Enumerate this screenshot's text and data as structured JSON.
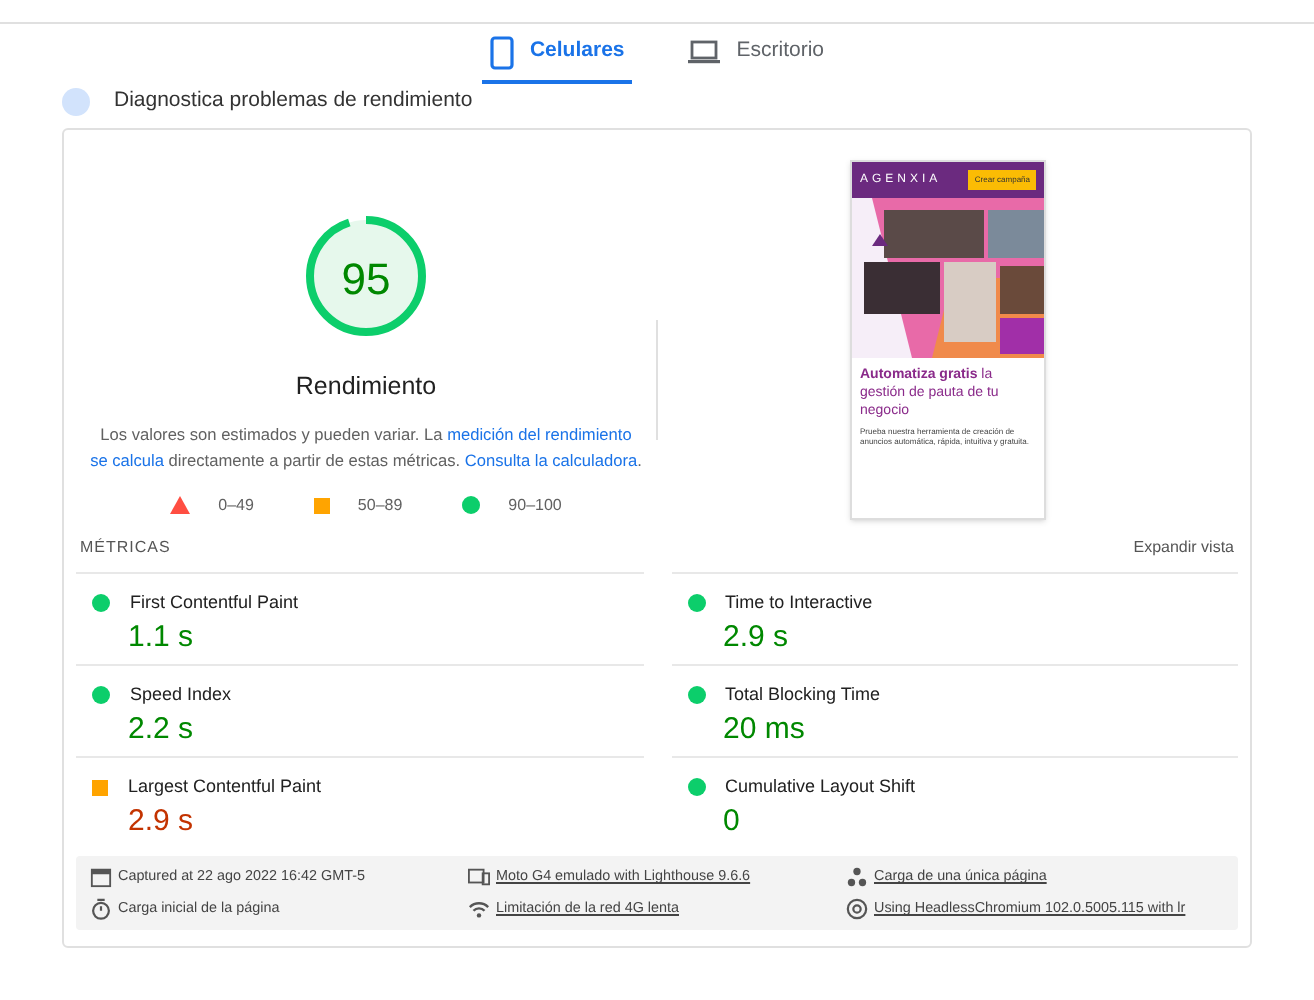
{
  "tabs": [
    {
      "label": "Celulares",
      "kind": "phone",
      "selected": true
    },
    {
      "label": "Escritorio",
      "kind": "desktop",
      "selected": false
    }
  ],
  "diagnostic_heading": "Diagnostica problemas de rendimiento",
  "score": {
    "value": "95",
    "level": 0.95,
    "label": "Rendimiento"
  },
  "description": {
    "text": "Los valores son estimados y pueden variar. La ",
    "link1": "medición del rendimiento",
    "link1_cont": "se calcula",
    "middle": " directamente a partir de estas métricas. ",
    "link2": "Consulta la calculadora",
    "end": "."
  },
  "legend": [
    {
      "kind": "fail",
      "range": "0–49"
    },
    {
      "kind": "average",
      "range": "50–89"
    },
    {
      "kind": "pass",
      "range": "90–100"
    }
  ],
  "screenshot": {
    "brand": "AGENXIA",
    "button": "Crear campaña",
    "headline_bold": "Automatiza gratis",
    "headline_rest": " la gestión de pauta de tu negocio",
    "body": "Prueba nuestra herramienta de creación de anuncios automática, rápida, intuitiva y gratuita."
  },
  "metrics_header": {
    "title": "MÉTRICAS",
    "toggle": "Expandir vista"
  },
  "metrics": [
    {
      "name": "First Contentful Paint",
      "value": "1.1 s",
      "kind": "pass"
    },
    {
      "name": "Time to Interactive",
      "value": "2.9 s",
      "kind": "pass"
    },
    {
      "name": "Speed Index",
      "value": "2.2 s",
      "kind": "pass"
    },
    {
      "name": "Total Blocking Time",
      "value": "20 ms",
      "kind": "pass"
    },
    {
      "name": "Largest Contentful Paint",
      "value": "2.9 s",
      "kind": "average"
    },
    {
      "name": "Cumulative Layout Shift",
      "value": "0",
      "kind": "pass"
    }
  ],
  "runtime": [
    {
      "kind": "calendar",
      "text": "Captured at 22 ago 2022 16:42 GMT-5",
      "link": false
    },
    {
      "kind": "device",
      "text": "Moto G4 emulado with Lighthouse 9.6.6",
      "link": true
    },
    {
      "kind": "dots",
      "text": "Carga de una única página",
      "link": true
    },
    {
      "kind": "timer",
      "text": "Carga inicial de la página",
      "link": false
    },
    {
      "kind": "wifi",
      "text": "Limitación de la red 4G lenta",
      "link": true
    },
    {
      "kind": "chrome",
      "text": "Using HeadlessChromium 102.0.5005.115 with lr",
      "link": true
    }
  ]
}
